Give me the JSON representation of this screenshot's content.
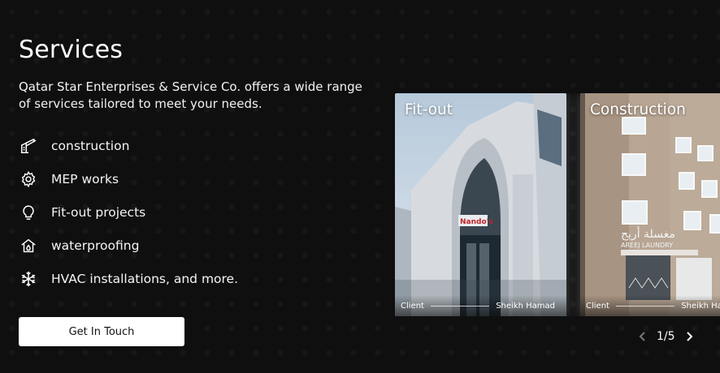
{
  "section": {
    "title": "Services",
    "description": "Qatar Star Enterprises & Service Co. offers a wide range of services tailored to meet your needs."
  },
  "services": [
    {
      "label": "construction",
      "icon": "crane-icon"
    },
    {
      "label": "MEP works",
      "icon": "gear-icon"
    },
    {
      "label": "Fit-out projects",
      "icon": "lightbulb-icon"
    },
    {
      "label": "waterproofing",
      "icon": "house-drop-icon"
    },
    {
      "label": "HVAC installations, and more.",
      "icon": "snowflake-icon"
    }
  ],
  "cta": {
    "label": "Get In Touch"
  },
  "cards": [
    {
      "title": "Fit-out",
      "client_label": "Client",
      "client_name": "Sheikh Hamad"
    },
    {
      "title": "Construction",
      "client_label": "Client",
      "client_name": "Sheikh Hamad"
    }
  ],
  "pager": {
    "current": "1/5"
  },
  "colors": {
    "background": "#0f0f10",
    "text": "#ffffff",
    "button_bg": "#ffffff",
    "button_text": "#111111"
  }
}
